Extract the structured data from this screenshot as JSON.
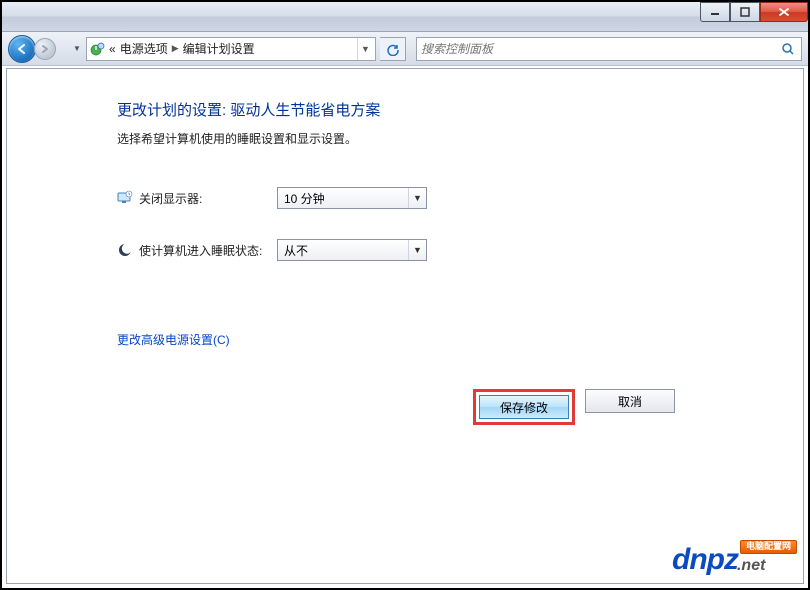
{
  "titlebar": {},
  "nav": {
    "breadcrumb_prefix": "«",
    "crumb1": "电源选项",
    "crumb2": "编辑计划设置"
  },
  "search": {
    "placeholder": "搜索控制面板"
  },
  "main": {
    "heading": "更改计划的设置: 驱动人生节能省电方案",
    "subtext": "选择希望计算机使用的睡眠设置和显示设置。",
    "row1_label": "关闭显示器:",
    "row1_value": "10 分钟",
    "row2_label": "使计算机进入睡眠状态:",
    "row2_value": "从不",
    "advanced_link": "更改高级电源设置(C)"
  },
  "actions": {
    "save": "保存修改",
    "cancel": "取消"
  },
  "watermark": {
    "brand": "dnpz",
    "tag": "电脑配置网",
    "suffix": ".net"
  }
}
